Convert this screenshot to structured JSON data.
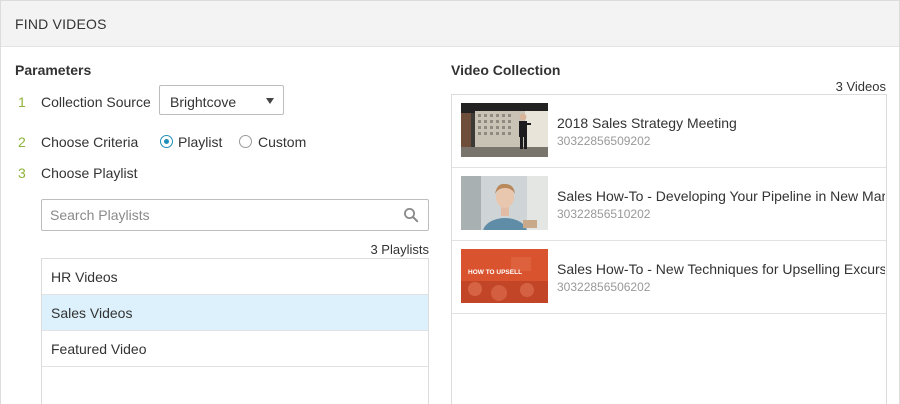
{
  "header": {
    "title": "FIND VIDEOS"
  },
  "parameters": {
    "title": "Parameters",
    "steps": [
      {
        "num": "1",
        "label": "Collection Source"
      },
      {
        "num": "2",
        "label": "Choose Criteria"
      },
      {
        "num": "3",
        "label": "Choose Playlist"
      }
    ],
    "collection_source": {
      "selected": "Brightcove"
    },
    "criteria": {
      "options": [
        {
          "label": "Playlist",
          "checked": true
        },
        {
          "label": "Custom",
          "checked": false
        }
      ]
    },
    "search": {
      "placeholder": "Search Playlists",
      "value": ""
    },
    "playlist_count": "3 Playlists",
    "playlists": [
      {
        "label": "HR Videos",
        "selected": false
      },
      {
        "label": "Sales Videos",
        "selected": true
      },
      {
        "label": "Featured Video",
        "selected": false
      }
    ]
  },
  "collection": {
    "title": "Video Collection",
    "count": "3 Videos",
    "videos": [
      {
        "title": "2018 Sales Strategy Meeting",
        "id": "30322856509202",
        "thumb": "meeting"
      },
      {
        "title": "Sales How-To - Developing Your Pipeline in New Markets",
        "id": "30322856510202",
        "thumb": "person"
      },
      {
        "title": "Sales How-To - New Techniques for Upselling Excursions",
        "id": "30322856506202",
        "thumb": "upsell",
        "thumb_text": "HOW TO UPSELL"
      }
    ]
  },
  "colors": {
    "accent": "#1f8fb8",
    "step_number": "#8fb33a",
    "selected_row": "#dcf1fb",
    "upsell_thumb": "#d9532f"
  }
}
